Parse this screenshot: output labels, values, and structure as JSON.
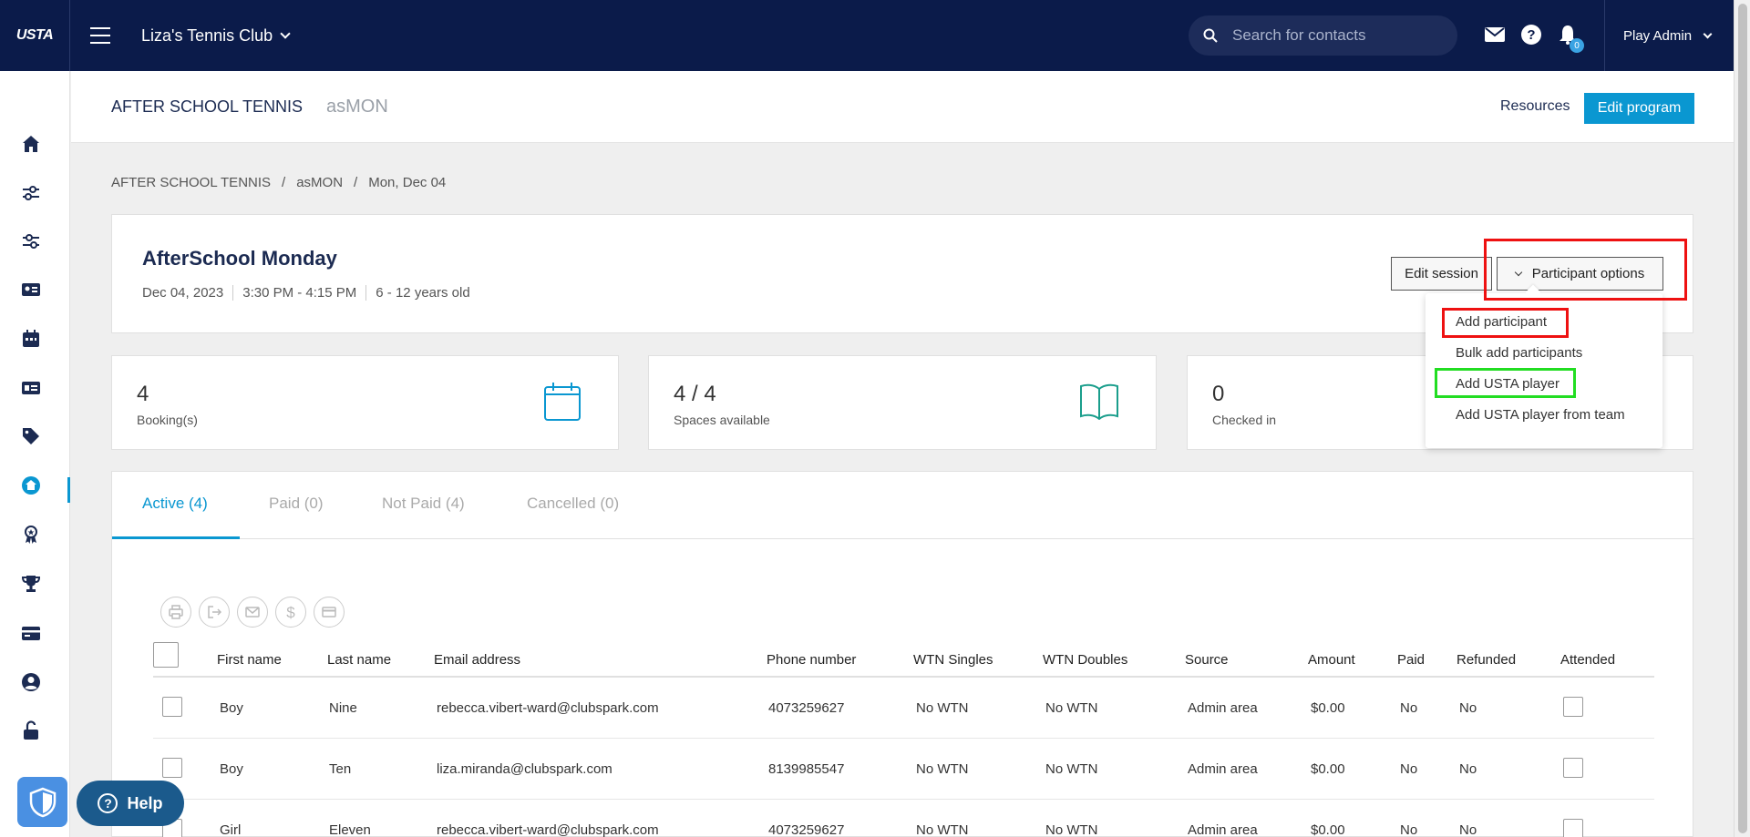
{
  "topbar": {
    "logo": "USTA",
    "club_name": "Liza's Tennis Club",
    "search_placeholder": "Search for contacts",
    "notifications_count": "0",
    "user": "Play Admin"
  },
  "header": {
    "program_title": "AFTER SCHOOL TENNIS",
    "program_sub": "asMON",
    "resources_label": "Resources",
    "edit_program_label": "Edit program"
  },
  "breadcrumb": {
    "items": [
      "AFTER SCHOOL TENNIS",
      "asMON",
      "Mon, Dec 04"
    ],
    "separator": "/"
  },
  "session": {
    "title": "AfterSchool Monday",
    "date": "Dec 04, 2023",
    "time": "3:30 PM - 4:15 PM",
    "ages": "6 - 12 years old",
    "edit_session_label": "Edit session",
    "participant_options_label": "Participant options"
  },
  "stats": [
    {
      "value": "4",
      "label": "Booking(s)",
      "icon": "calendar-icon"
    },
    {
      "value": "4 / 4",
      "label": "Spaces available",
      "icon": "book-icon"
    },
    {
      "value": "0",
      "label": "Checked in",
      "icon": "check-icon"
    }
  ],
  "dropdown": {
    "items": [
      "Add participant",
      "Bulk add participants",
      "Add USTA player",
      "Add USTA player from team"
    ]
  },
  "tabs": [
    {
      "label": "Active (4)",
      "active": true
    },
    {
      "label": "Paid (0)",
      "active": false
    },
    {
      "label": "Not Paid (4)",
      "active": false
    },
    {
      "label": "Cancelled (0)",
      "active": false
    }
  ],
  "table": {
    "columns": [
      "First name",
      "Last name",
      "Email address",
      "Phone number",
      "WTN Singles",
      "WTN Doubles",
      "Source",
      "Amount",
      "Paid",
      "Refunded",
      "Attended"
    ],
    "rows": [
      [
        "Boy",
        "Nine",
        "rebecca.vibert-ward@clubspark.com",
        "4073259627",
        "No WTN",
        "No WTN",
        "Admin area",
        "$0.00",
        "No",
        "No"
      ],
      [
        "Boy",
        "Ten",
        "liza.miranda@clubspark.com",
        "8139985547",
        "No WTN",
        "No WTN",
        "Admin area",
        "$0.00",
        "No",
        "No"
      ],
      [
        "Girl",
        "Eleven",
        "rebecca.vibert-ward@clubspark.com",
        "4073259627",
        "No WTN",
        "No WTN",
        "Admin area",
        "$0.00",
        "No",
        "No"
      ]
    ]
  },
  "help_label": "Help",
  "colors": {
    "navy": "#0b1b4a",
    "accent": "#0a97d1",
    "highlight_red": "#ee1111",
    "highlight_green": "#22dd22"
  }
}
